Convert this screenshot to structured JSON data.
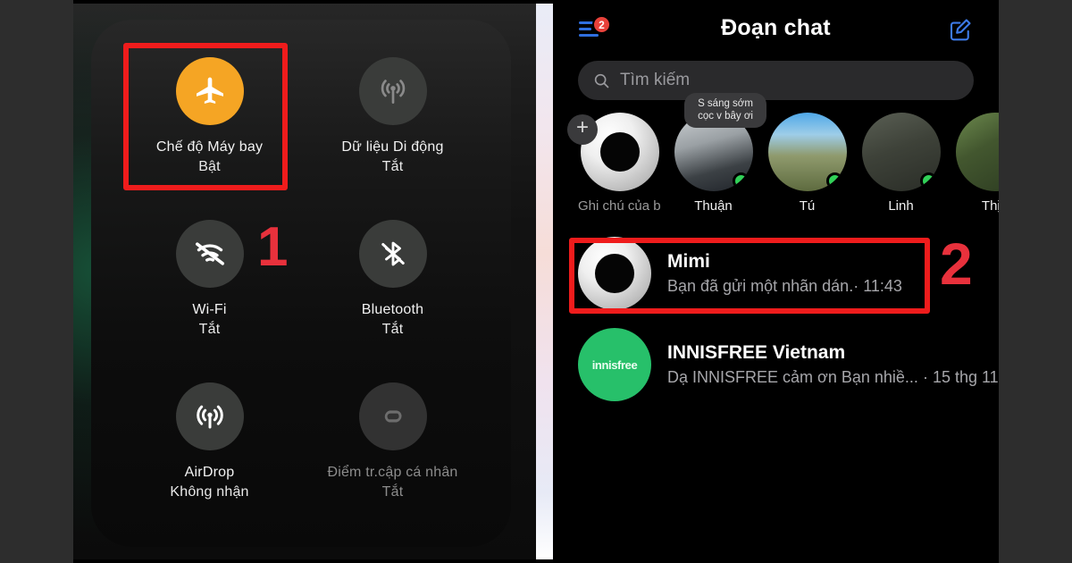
{
  "left_panel": {
    "name": "ios-control-center",
    "highlight_number": "1",
    "tiles": [
      {
        "id": "airplane-mode",
        "icon": "airplane-icon",
        "label": "Chế độ Máy bay",
        "state": "Bật",
        "active": true
      },
      {
        "id": "cellular-data",
        "icon": "cellular-signal-icon",
        "label": "Dữ liệu Di động",
        "state": "Tắt",
        "active": false
      },
      {
        "id": "wifi",
        "icon": "wifi-off-icon",
        "label": "Wi-Fi",
        "state": "Tắt",
        "active": false
      },
      {
        "id": "bluetooth",
        "icon": "bluetooth-off-icon",
        "label": "Bluetooth",
        "state": "Tắt",
        "active": false
      },
      {
        "id": "airdrop",
        "icon": "airdrop-icon",
        "label": "AirDrop",
        "state": "Không nhận",
        "active": false
      },
      {
        "id": "personal-hotspot",
        "icon": "hotspot-icon",
        "label": "Điểm tr.cập cá nhân",
        "state": "Tắt",
        "active": false
      }
    ]
  },
  "right_panel": {
    "name": "messenger-chats",
    "highlight_number": "2",
    "header": {
      "menu_icon": "menu-icon",
      "badge_count": "2",
      "title": "Đoạn chat",
      "compose_icon": "compose-icon"
    },
    "search": {
      "icon": "search-icon",
      "placeholder": "Tìm kiếm"
    },
    "stories": [
      {
        "name": "Ghi chú của b...",
        "avatar": "donut-avatar",
        "online": false,
        "muted": true,
        "note": ""
      },
      {
        "name": "Thuận",
        "avatar": "photo-avatar",
        "online": true,
        "muted": false,
        "note": "S sáng sớm cọc v bây ơi"
      },
      {
        "name": "Tú",
        "avatar": "photo-avatar",
        "online": true,
        "muted": false,
        "note": ""
      },
      {
        "name": "Linh",
        "avatar": "photo-avatar",
        "online": true,
        "muted": false,
        "note": ""
      },
      {
        "name": "Thịn",
        "avatar": "photo-avatar",
        "online": false,
        "muted": false,
        "note": ""
      }
    ],
    "add_note_label": "+",
    "chats": [
      {
        "name": "Mimi",
        "preview": "Bạn đã gửi một nhãn dán.",
        "separator": "·",
        "time": "11:43",
        "avatar": "donut-avatar",
        "highlighted": true
      },
      {
        "name": "INNISFREE Vietnam",
        "preview": "Dạ INNISFREE cảm ơn Bạn nhiề...",
        "separator": "·",
        "time": "15 thg 11",
        "avatar": "innisfree-logo",
        "avatar_text": "innisfree",
        "highlighted": false
      }
    ]
  },
  "colors": {
    "highlight_red": "#ef1c1c",
    "number_red": "#e8313c",
    "airplane_orange": "#F5A524",
    "badge_red": "#e8413a",
    "online_green": "#31d158",
    "innisfree_green": "#27c06a",
    "accent_blue": "#2f6fe0"
  }
}
